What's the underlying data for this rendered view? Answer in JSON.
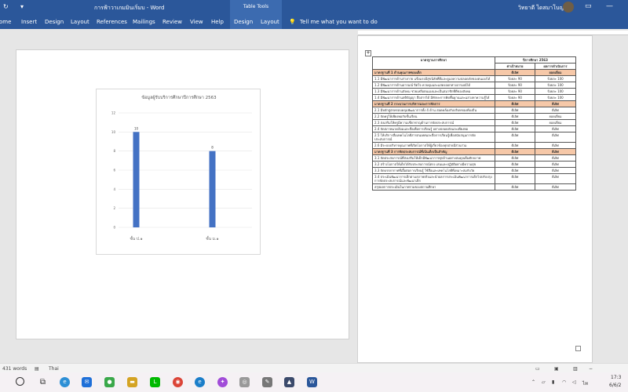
{
  "window": {
    "title": "การฟ้าวาเกมมินเริ่มบ - Word",
    "context_tab": "Table Tools",
    "user": "วิทยาดี ไดสมาโบญ"
  },
  "ribbon": {
    "tabs": [
      "ome",
      "Insert",
      "Design",
      "Layout",
      "References",
      "Mailings",
      "Review",
      "View",
      "Help",
      "Design",
      "Layout"
    ],
    "tell_me": "Tell me what you want to do"
  },
  "chart_data": {
    "type": "bar",
    "title": "ข้อมูลผู้รับบริการศึกษาปีการศึกษา 2563",
    "categories": [
      "ชั้น ป.๑",
      "ชั้น ม.๑"
    ],
    "values": [
      10,
      8
    ],
    "data_labels": [
      "10",
      "8"
    ],
    "ylim": [
      0,
      12
    ],
    "yticks": [
      0,
      2,
      4,
      6,
      8,
      10,
      12
    ],
    "grid": true,
    "bar_color": "#4472c4"
  },
  "table": {
    "header": {
      "col1": "มาตรฐานการศึกษา",
      "col2": "ปีการศึกษา 2563",
      "col2a": "ค่าเป้าหมาย",
      "col2b": "ผลการดำเนินการ"
    },
    "rows": [
      {
        "type": "sec",
        "text": "มาตรฐานที่ 1 ด้านคุณภาพของเด็ก",
        "a": "ดีเลิศ",
        "b": "ยอดเยี่ยม"
      },
      {
        "type": "row",
        "text": "1.1 มีพัฒนาการด้านร่างกาย แข็งแรงมีสุขนิสัยที่ดีและดูแลความปลอดภัยของตนเองได้",
        "a": "ร้อยละ 90",
        "b": "ร้อยละ 100"
      },
      {
        "type": "row",
        "text": "1.2 มีพัฒนาการด้านอารมณ์ จิตใจ ควบคุมและแสดงออกทางอารมณ์ได้",
        "a": "ร้อยละ 90",
        "b": "ร้อยละ 100"
      },
      {
        "type": "row",
        "text": "1.3 มีพัฒนาการด้านสังคม ช่วยเหลือตนเองและเป็นสมาชิกที่ดีของสังคม",
        "a": "ร้อยละ 90",
        "b": "ร้อยละ 100"
      },
      {
        "type": "row",
        "text": "1.4 มีพัฒนาการด้านสติปัญญา สื่อสารได้ มีทักษะการคิดพื้นฐานและแสวงหาความรู้ได้",
        "a": "ร้อยละ 90",
        "b": "ร้อยละ 100"
      },
      {
        "type": "sec",
        "text": "มาตรฐานที่ 2 กระบวนการบริหารและการจัดการ",
        "a": "ดีเลิศ",
        "b": "ดีเลิศ"
      },
      {
        "type": "row",
        "text": "2.1 มีหลักสูตรครอบคลุมพัฒนาการทั้ง 4 ด้าน สอดคล้องกับบริบทของท้องถิ่น",
        "a": "ดีเลิศ",
        "b": "ดีเลิศ"
      },
      {
        "type": "row",
        "text": "2.2 จัดครูให้เพียงพอกับชั้นเรียน",
        "a": "ดีเลิศ",
        "b": "ยอดเยี่ยม"
      },
      {
        "type": "row",
        "text": "2.3 ส่งเสริมให้ครูมีความเชี่ยวชาญด้านการจัดประสบการณ์",
        "a": "ดีเลิศ",
        "b": "ยอดเยี่ยม"
      },
      {
        "type": "row",
        "text": "2.4 จัดสภาพแวดล้อมและสื่อเพื่อการเรียนรู้ อย่างปลอดภัยและเพียงพอ",
        "a": "ดีเลิศ",
        "b": "ดีเลิศ"
      },
      {
        "type": "row",
        "text": "2.5 ให้บริการสื่อเทคโนโลยีสารสนเทศและสื่อการเรียนรู้เพื่อสนับสนุนการจัดประสบการณ์",
        "a": "ดีเลิศ",
        "b": "ดีเลิศ"
      },
      {
        "type": "row",
        "text": "2.6 มีระบบบริหารคุณภาพที่เปิดโอกาสให้ผู้เกี่ยวข้องทุกฝ่ายมีส่วนร่วม",
        "a": "ดีเลิศ",
        "b": "ดีเลิศ"
      },
      {
        "type": "sec",
        "text": "มาตรฐานที่ 3 การจัดประสบการณ์ที่เน้นเด็กเป็นสำคัญ",
        "a": "ดีเลิศ",
        "b": "ดีเลิศ"
      },
      {
        "type": "row",
        "text": "3.1 จัดประสบการณ์ที่ส่งเสริมให้เด็กมีพัฒนาการทุกด้านอย่างสมดุลเต็มศักยภาพ",
        "a": "ดีเลิศ",
        "b": "ดีเลิศ"
      },
      {
        "type": "row",
        "text": "3.2 สร้างโอกาสให้เด็กได้รับประสบการณ์ตรง เล่นและปฏิบัติอย่างมีความสุข",
        "a": "ดีเลิศ",
        "b": "ดีเลิศ"
      },
      {
        "type": "row",
        "text": "3.3 จัดบรรยากาศที่เอื้อต่อการเรียนรู้ ใช้สื่อและเทคโนโลยีที่เหมาะสมกับวัย",
        "a": "ดีเลิศ",
        "b": "ดีเลิศ"
      },
      {
        "type": "row",
        "text": "3.4 ประเมินพัฒนาการเด็กตามสภาพจริงและนำผลการประเมินพัฒนาการเด็กไปปรับปรุงการจัดประสบการณ์และพัฒนาเด็ก",
        "a": "ดีเลิศ",
        "b": "ดีเลิศ"
      },
      {
        "type": "row",
        "text": "สรุปผลการประเมินในภาพรวมของสถานศึกษา",
        "a": "ดีเลิศ",
        "b": "ดีเลิศ"
      }
    ]
  },
  "status": {
    "words": "431 words",
    "language": "Thai"
  },
  "tray": {
    "time": "17:3",
    "date": "6/6/2"
  },
  "colors": {
    "ribbon": "#2b579a",
    "section_row": "#f6c8a8",
    "bar": "#4472c4"
  }
}
